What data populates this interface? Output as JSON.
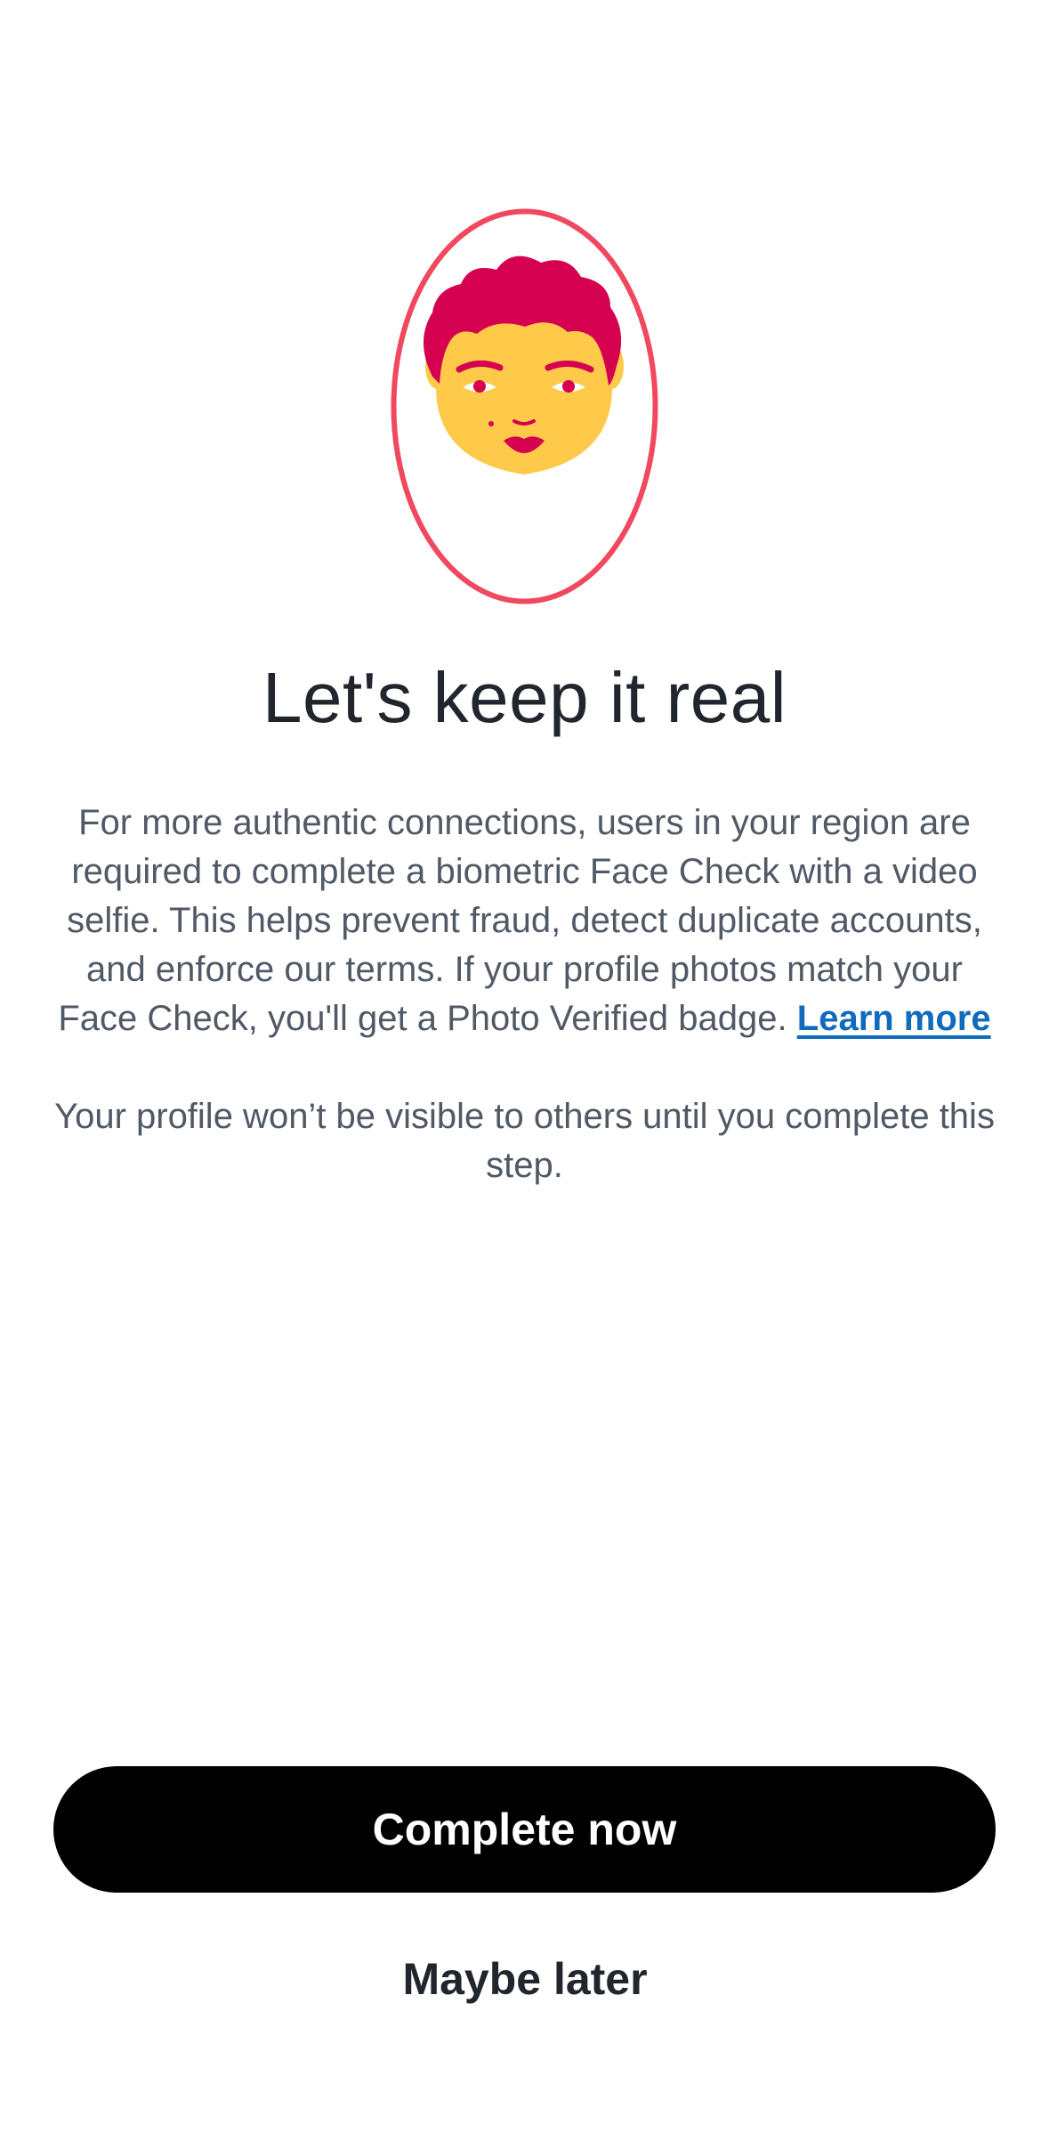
{
  "illustration": {
    "icon": "face-check-illustration",
    "colors": {
      "ring": "#f0485f",
      "hair": "#d5004f",
      "skin": "#ffc94a"
    }
  },
  "title": "Let's keep it real",
  "description": {
    "paragraph1": "For more authentic connections, users in your region are required to complete a biometric Face Check with a video selfie. This helps prevent fraud, detect duplicate accounts, and enforce our terms. If your profile photos match your Face Check, you'll get a Photo Verified badge.",
    "learn_more_link": "Learn more",
    "paragraph2": "Your profile won’t be visible to others until you complete this step."
  },
  "actions": {
    "complete_now": "Complete now",
    "maybe_later": "Maybe later"
  },
  "colors": {
    "primary_button_bg": "#000000",
    "primary_button_text": "#ffffff",
    "link": "#106bbd",
    "title_text": "#21262e",
    "body_text": "#505965"
  }
}
